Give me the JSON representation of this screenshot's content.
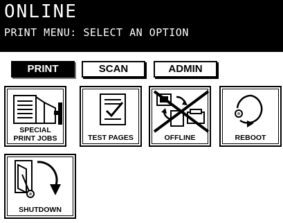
{
  "header": {
    "status": "ONLINE",
    "subtitle": "PRINT MENU: SELECT AN OPTION"
  },
  "tabs": [
    {
      "label": "PRINT",
      "active": true
    },
    {
      "label": "SCAN",
      "active": false
    },
    {
      "label": "ADMIN",
      "active": false
    }
  ],
  "tiles": {
    "special": {
      "line1": "SPECIAL",
      "line2": "PRINT JOBS",
      "icon": "document-stack-icon"
    },
    "test": {
      "label": "TEST PAGES",
      "icon": "checklist-icon"
    },
    "offline": {
      "label": "OFFLINE",
      "icon": "offline-icon"
    },
    "reboot": {
      "label": "REBOOT",
      "icon": "reboot-icon"
    },
    "shutdown": {
      "label": "SHUTDOWN",
      "icon": "shutdown-icon"
    }
  }
}
